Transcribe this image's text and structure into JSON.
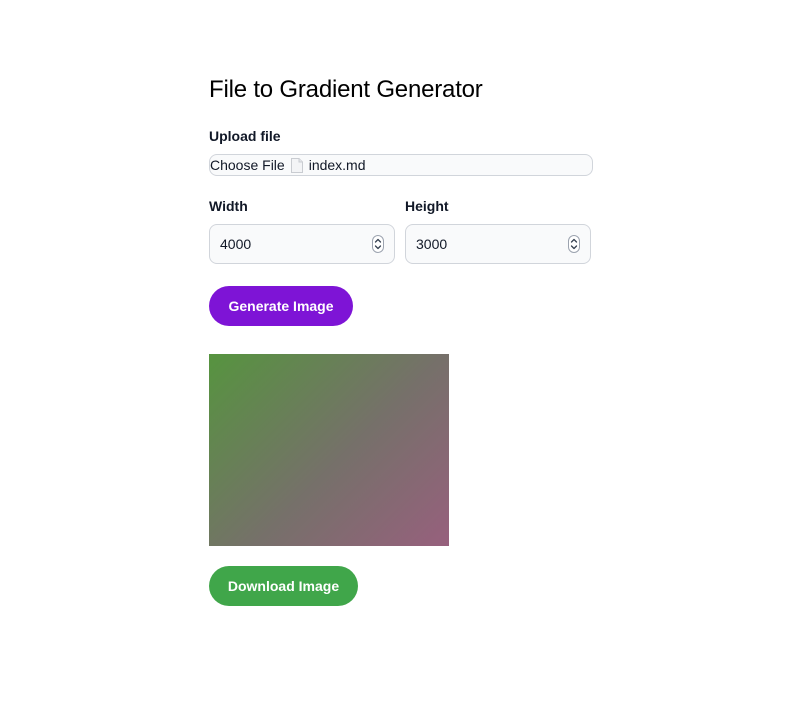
{
  "page": {
    "title": "File to Gradient Generator"
  },
  "upload": {
    "label": "Upload file",
    "button_label": "Choose File",
    "file_icon": "document-icon",
    "file_name": "index.md"
  },
  "dimensions": {
    "width_label": "Width",
    "width_value": "4000",
    "height_label": "Height",
    "height_value": "3000",
    "stepper_icon": "up-down-chevron-icon"
  },
  "actions": {
    "generate_label": "Generate Image",
    "download_label": "Download Image"
  },
  "preview": {
    "description": "gradient image",
    "gradient_colors": [
      "#56943f",
      "#76706a",
      "#97607d"
    ]
  },
  "colors": {
    "generate_button": "#7e14d6",
    "download_button": "#40a64a",
    "input_background": "#f9fafb",
    "input_border": "#d1d5db"
  }
}
